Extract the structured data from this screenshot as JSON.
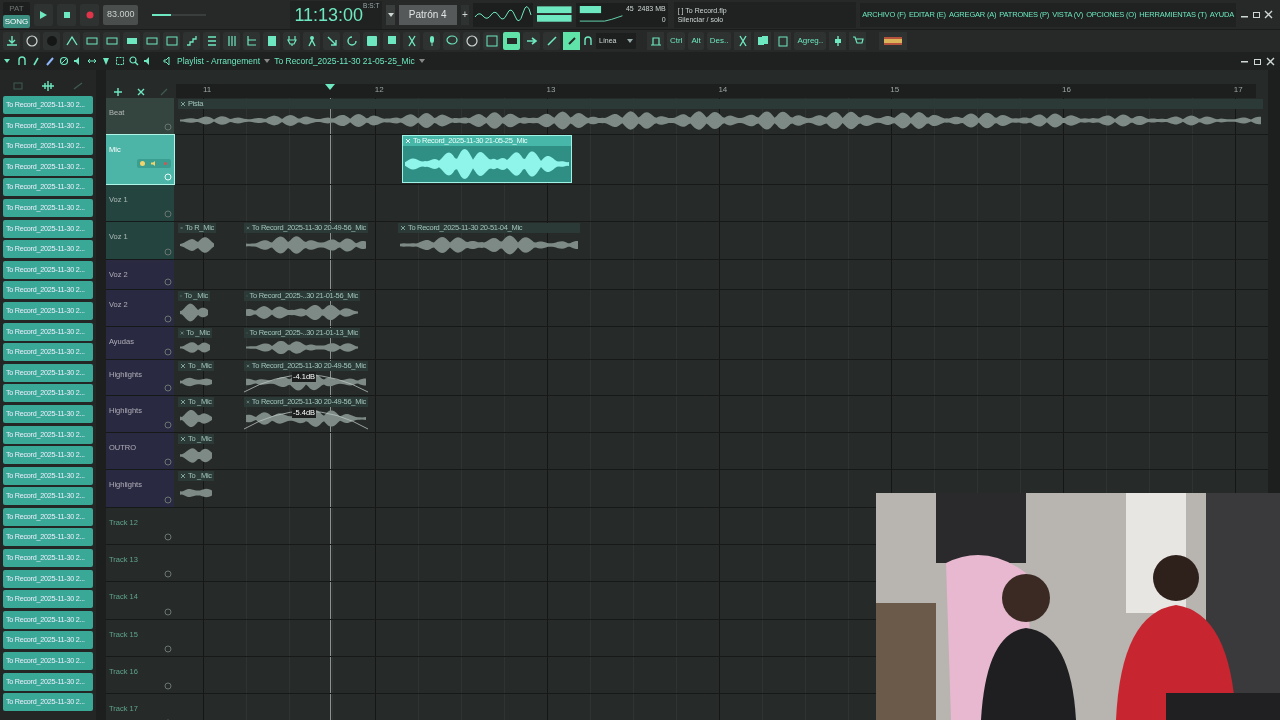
{
  "transport": {
    "volume": {
      "level": 0.35
    },
    "modes": [
      {
        "label": "PAT",
        "selected": false
      },
      {
        "label": "SONG",
        "selected": true
      }
    ],
    "tempo": "83.000",
    "time": "11:13:00",
    "time_format": "B:S:T",
    "pattern": "Patrón 4",
    "pattern_add": "+",
    "cpu": "45",
    "memory": "2483 MB",
    "polyphony": "0"
  },
  "hint_bar": {
    "file": "[ ] To Record.flp",
    "hint": "Silenciar / solo"
  },
  "menu": [
    "ARCHIVO (F)",
    "EDITAR (E)",
    "AGREGAR (A)",
    "PATRONES (P)",
    "VISTA (V)",
    "OPCIONES (O)",
    "HERRAMIENTAS (T)",
    "AYUDA"
  ],
  "toolbar": {
    "snap": "Línea",
    "buttons": [
      "Ctrl",
      "Alt",
      "Des..",
      "Agreg.."
    ]
  },
  "playlist": {
    "title": "Playlist - Arrangement",
    "clip_source": "To Record_2025-11-30 21-05-25_Mic",
    "picker_items": [
      "To Record_2025-11-30 2...",
      "To Record_2025-11-30 2...",
      "To Record_2025-11-30 2...",
      "To Record_2025-11-30 2...",
      "To Record_2025-11-30 2...",
      "To Record_2025-11-30 2...",
      "To Record_2025-11-30 2...",
      "To Record_2025-11-30 2...",
      "To Record_2025-11-30 2...",
      "To Record_2025-11-30 2...",
      "To Record_2025-11-30 2...",
      "To Record_2025-11-30 2...",
      "To Record_2025-11-30 2...",
      "To Record_2025-11-30 2...",
      "To Record_2025-11-30 2...",
      "To Record_2025-11-30 2...",
      "To Record_2025-11-30 2...",
      "To Record_2025-11-30 2...",
      "To Record_2025-11-30 2...",
      "To Record_2025-11-30 2...",
      "To Record_2025-11-30 2...",
      "To Record_2025-11-30 2...",
      "To Record_2025-11-30 2...",
      "To Record_2025-11-30 2...",
      "To Record_2025-11-30 2...",
      "To Record_2025-11-30 2...",
      "To Record_2025-11-30 2...",
      "To Record_2025-11-30 2...",
      "To Record_2025-11-30 2...",
      "To Record_2025-11-30 2..."
    ],
    "ruler": [
      "11",
      "12",
      "13",
      "14",
      "15",
      "16",
      "17"
    ],
    "tracks": [
      {
        "name": "Beat",
        "color": "#34443f",
        "selected": false,
        "clips": [
          {
            "kind": "audio",
            "label": "Pista",
            "selected": false
          }
        ]
      },
      {
        "name": "Mic",
        "color": "#4db5a8",
        "selected": true,
        "clips": [
          {
            "kind": "audio",
            "label": "To Record_2025-11-30 21-05-25_Mic",
            "selected": true
          }
        ]
      },
      {
        "name": "Voz 1",
        "color": "#24443f",
        "selected": false
      },
      {
        "name": "Voz 1",
        "color": "#24443f",
        "selected": false,
        "clips": [
          {
            "kind": "audio",
            "label": "To R_Mic",
            "selected": false
          },
          {
            "kind": "audio",
            "label": "To Record_2025-11-30 20-49-56_Mic",
            "selected": false
          },
          {
            "kind": "audio",
            "label": "To Record_2025-11-30 20-51-04_Mic",
            "selected": false
          }
        ]
      },
      {
        "name": "Voz 2",
        "color": "#2a2942",
        "selected": false
      },
      {
        "name": "Voz 2",
        "color": "#2a2942",
        "selected": false,
        "clips": [
          {
            "kind": "audio",
            "label": "To _Mic",
            "selected": false
          },
          {
            "kind": "audio",
            "label": "To Record_2025-..30 21-01-56_Mic",
            "selected": false
          }
        ]
      },
      {
        "name": "Ayudas",
        "color": "#2a2942",
        "selected": false,
        "clips": [
          {
            "kind": "audio",
            "label": "To _Mic",
            "selected": false
          },
          {
            "kind": "audio",
            "label": "To Record_2025-..30 21-01-13_Mic",
            "selected": false
          }
        ]
      },
      {
        "name": "Highlights",
        "color": "#2a2942",
        "selected": false,
        "clips": [
          {
            "kind": "audio",
            "label": "To _Mic",
            "selected": false
          },
          {
            "kind": "volume",
            "label": "To Record_2025-11-30 20-49-56_Mic",
            "gain": "-4.1dB",
            "selected": false
          }
        ]
      },
      {
        "name": "Highlights",
        "color": "#2a2942",
        "selected": false,
        "clips": [
          {
            "kind": "audio",
            "label": "To _Mic",
            "selected": false
          },
          {
            "kind": "volume",
            "label": "To Record_2025-11-30 20-49-56_Mic",
            "gain": "-5.4dB",
            "selected": false
          }
        ]
      },
      {
        "name": "OUTRO",
        "color": "#2a2942",
        "selected": false,
        "clips": [
          {
            "kind": "audio",
            "label": "To _Mic",
            "selected": false
          }
        ]
      },
      {
        "name": "Highlights",
        "color": "#2a2942",
        "selected": false,
        "clips": [
          {
            "kind": "audio",
            "label": "To _Mic",
            "selected": false
          }
        ]
      },
      {
        "name": "Track 12",
        "selected": false
      },
      {
        "name": "Track 13",
        "selected": false
      },
      {
        "name": "Track 14",
        "selected": false
      },
      {
        "name": "Track 15",
        "selected": false
      },
      {
        "name": "Track 16",
        "selected": false
      },
      {
        "name": "Track 17",
        "selected": false
      }
    ]
  }
}
